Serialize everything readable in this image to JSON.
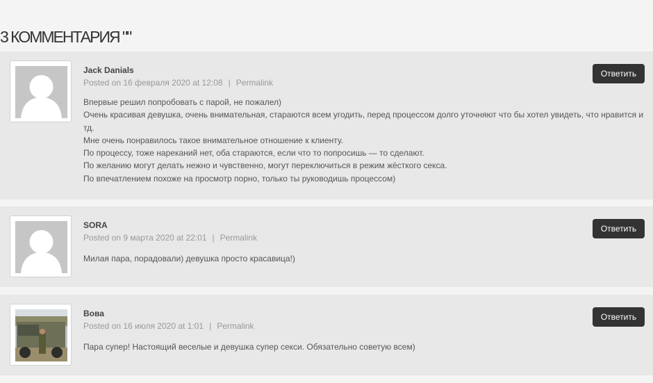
{
  "heading": "3 КОММЕНТАРИЯ \"\"",
  "reply_label": "Ответить",
  "comments": [
    {
      "author": "Jack Danials",
      "date": "Posted on 16 февраля 2020 at 12:08",
      "permalink": "Permalink",
      "avatar": "default-avatar",
      "lines": [
        "Впервые решил попробовать с парой, не пожалел)",
        "Очень красивая девушка, очень внимательная, стараются всем угодить, перед процессом долго уточняют что бы хотел увидеть, что нравится и тд.",
        "Мне очень понравилось такое внимательное отношение к клиенту.",
        "По процессу, тоже нареканий нет, оба стараются, если что то попросишь — то сделают.",
        "По желанию могут делать нежно и чувственно, могут переключиться в режим жёсткого секса.",
        "По впечатлением похоже на просмотр порно, только ты руководишь процессом)"
      ]
    },
    {
      "author": "SORA",
      "date": "Posted on 9 марта 2020 at 22:01",
      "permalink": "Permalink",
      "avatar": "default-avatar",
      "lines": [
        "Милая пара, порадовали) девушка просто красавица!)"
      ]
    },
    {
      "author": "Вова",
      "date": "Posted on 16 июля 2020 at 1:01",
      "permalink": "Permalink",
      "avatar": "photo-avatar",
      "lines": [
        "Пара супер! Настоящий веселые и девушка супер секси. Обязательно советую всем)"
      ]
    }
  ]
}
